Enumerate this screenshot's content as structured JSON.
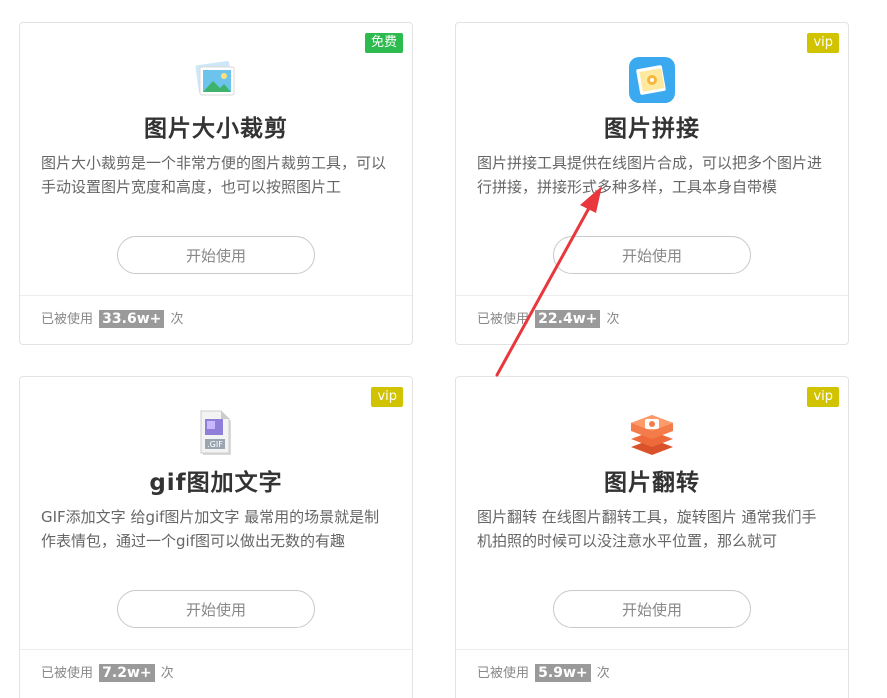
{
  "cards": [
    {
      "badge": "免费",
      "badge_type": "free",
      "icon": "image-picture-icon",
      "title": "图片大小裁剪",
      "description": "图片大小裁剪是一个非常方便的图片裁剪工具，可以手动设置图片宽度和高度，也可以按照图片工",
      "button": "开始使用",
      "usage_prefix": "已被使用",
      "usage_count": "33.6w+",
      "usage_suffix": "次"
    },
    {
      "badge": "vip",
      "badge_type": "vip",
      "icon": "photo-collage-icon",
      "title": "图片拼接",
      "description": "图片拼接工具提供在线图片合成，可以把多个图片进行拼接，拼接形式多种多样，工具本身自带模",
      "button": "开始使用",
      "usage_prefix": "已被使用",
      "usage_count": "22.4w+",
      "usage_suffix": "次"
    },
    {
      "badge": "vip",
      "badge_type": "vip",
      "icon": "gif-file-icon",
      "title": "gif图加文字",
      "description": "GIF添加文字 给gif图片加文字 最常用的场景就是制作表情包，通过一个gif图可以做出无数的有趣",
      "button": "开始使用",
      "usage_prefix": "已被使用",
      "usage_count": "7.2w+",
      "usage_suffix": "次"
    },
    {
      "badge": "vip",
      "badge_type": "vip",
      "icon": "image-flip-layers-icon",
      "title": "图片翻转",
      "description": "图片翻转 在线图片翻转工具，旋转图片 通常我们手机拍照的时候可以没注意水平位置，那么就可",
      "button": "开始使用",
      "usage_prefix": "已被使用",
      "usage_count": "5.9w+",
      "usage_suffix": "次"
    }
  ],
  "colors": {
    "free_badge": "#2dbb4f",
    "vip_badge": "#d1c300",
    "annotation_arrow": "#e8383d"
  },
  "annotation": {
    "icon": "red-arrow-icon"
  }
}
